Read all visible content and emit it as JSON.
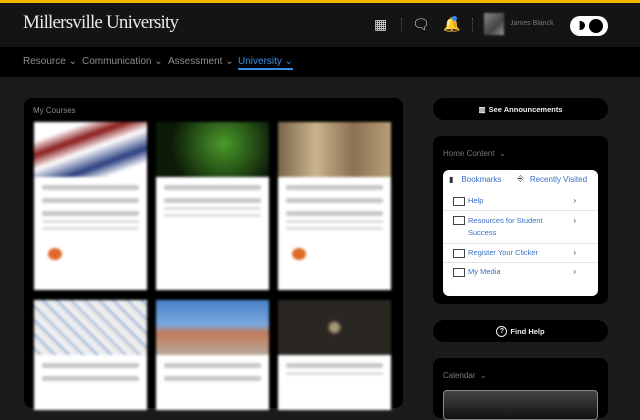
{
  "header": {
    "logo": "Millersville University",
    "user_name": "James Blanck",
    "icons": [
      "grid-icon",
      "chat-icon",
      "bell-icon"
    ],
    "notification_dot_color": "#2f8cf0",
    "accent": "#f2b600"
  },
  "nav": {
    "items": [
      {
        "label": "Resource"
      },
      {
        "label": "Communication"
      },
      {
        "label": "Assessment"
      },
      {
        "label": "University",
        "active": true
      }
    ]
  },
  "courses": {
    "title": "My Courses"
  },
  "announcements": {
    "label": "See Announcements"
  },
  "home_content": {
    "title": "Home Content",
    "tabs": [
      "Bookmarks",
      "Recently Visited"
    ],
    "items": [
      "Help",
      "Resources for Student Success",
      "Register Your Clicker",
      "My Media"
    ]
  },
  "find_help": {
    "label": "Find Help"
  },
  "calendar": {
    "title": "Calendar"
  }
}
